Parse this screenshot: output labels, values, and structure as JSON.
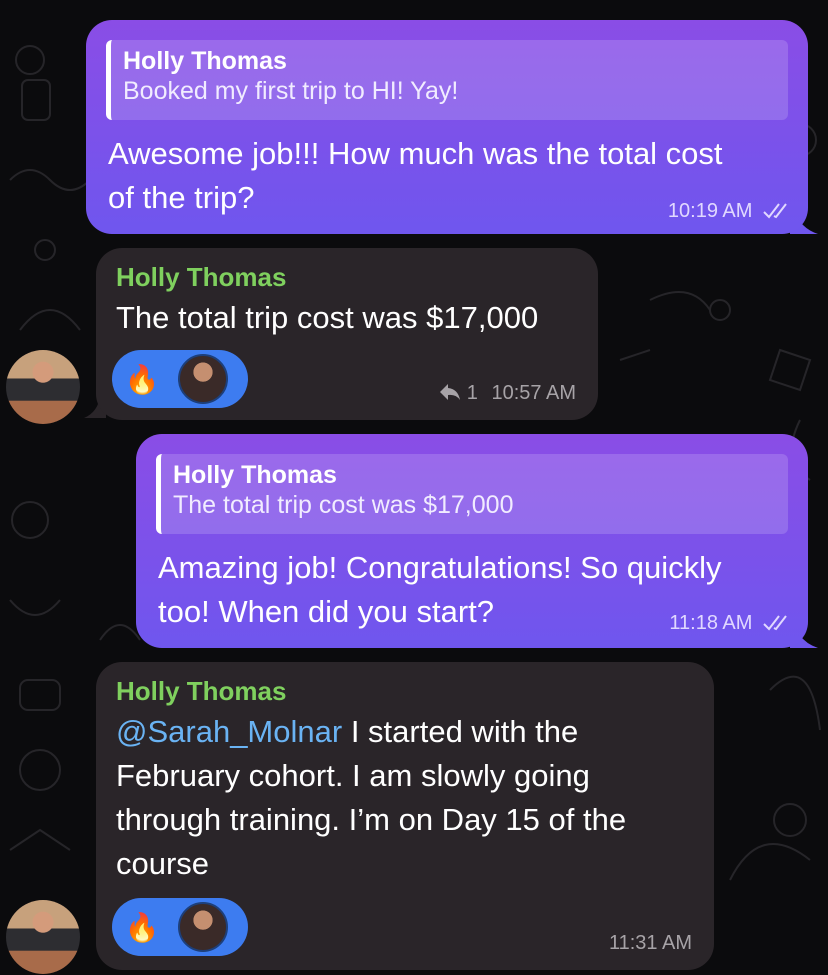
{
  "messages": [
    {
      "direction": "outgoing",
      "reply_to": {
        "sender": "Holly Thomas",
        "text": "Booked my first trip to HI! Yay!"
      },
      "text_lines": [
        "Awesome job!!! How much was the total cost",
        "of the trip?"
      ],
      "time": "10:19 AM",
      "status": "read"
    },
    {
      "direction": "incoming",
      "sender": "Holly Thomas",
      "text": "The total trip cost was $17,000",
      "reactions": [
        "🔥"
      ],
      "reply_count": "1",
      "time": "10:57 AM"
    },
    {
      "direction": "outgoing",
      "reply_to": {
        "sender": "Holly Thomas",
        "text": "The total trip cost was $17,000"
      },
      "text_lines": [
        "Amazing job! Congratulations! So quickly",
        "too! When did you start?"
      ],
      "time": "11:18 AM",
      "status": "read"
    },
    {
      "direction": "incoming",
      "sender": "Holly Thomas",
      "mention": "@Sarah_Molnar",
      "text_lines": [
        " I started with the",
        "February cohort.  I am slowly going",
        "through training.  I’m on Day 15 of the",
        "course"
      ],
      "reactions": [
        "🔥"
      ],
      "time": "11:31 AM"
    }
  ],
  "colors": {
    "outgoing_bubble": "#7f52ea",
    "incoming_bubble": "#2a2529",
    "sender_name": "#7fd05e",
    "mention": "#6ab3f3",
    "reaction_pill": "#3d7cf0"
  }
}
